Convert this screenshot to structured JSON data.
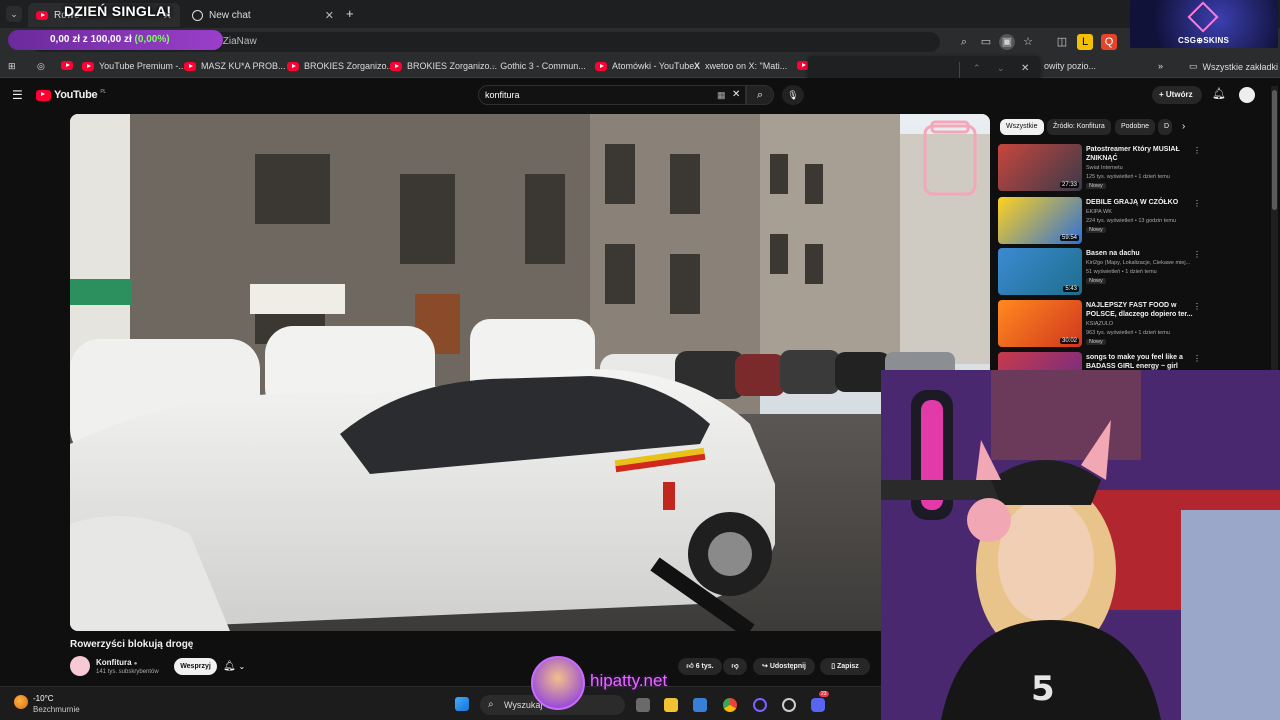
{
  "browser": {
    "tabs": [
      {
        "label": "Rowe",
        "active": true
      },
      {
        "label": "New chat",
        "active": false
      }
    ],
    "url_fragment": "/ZiaNaw",
    "bookmarks": [
      "YouTube Premium -...",
      "MASZ KU*A PROB...",
      "BROKIES Zorganizo...",
      "BROKIES Zorganizo...",
      "Gothic 3 - Commun...",
      "Atomówki - YouTube",
      "xwetoo on X: \"Mati...",
      "owity pozio..."
    ],
    "all_bookmarks_label": "Wszystkie zakładki"
  },
  "overlays": {
    "single_banner": "DZIEŃ SINGLA!",
    "donation_current": "0,00 zł",
    "donation_of": " z ",
    "donation_goal": "100,00 zł",
    "donation_percent": " (0,00%)",
    "csg_label": "CSG⊕SKINS",
    "hipatty": "hipatty.net"
  },
  "youtube": {
    "logo_text": "YouTube",
    "logo_region": "PL",
    "search_query": "konfitura",
    "create_label": "Utwórz",
    "video": {
      "title": "Rowerzyści blokują drogę",
      "channel": "Konfitura",
      "subscribers": "141 tys. subskrybentów",
      "support_label": "Wesprzyj",
      "likes": "6 tys.",
      "share_label": "Udostępnij",
      "save_label": "Zapisz"
    },
    "chips": [
      "Wszystkie",
      "Źródło: Konfitura",
      "Podobne",
      "D"
    ],
    "recommendations": [
      {
        "title": "Patostreamer Który MUSIAŁ ZNIKNĄĆ",
        "channel": "Świat Internetu",
        "meta": "125 tys. wyświetleń • 1 dzień temu",
        "badge": "Nowy",
        "duration": "27:33",
        "colors": [
          "#c8463c",
          "#3a3a4a"
        ]
      },
      {
        "title": "DEBILE GRAJĄ W CZÓŁKO",
        "channel": "EKIPA WK",
        "meta": "224 tys. wyświetleń • 13 godzin temu",
        "badge": "Nowy",
        "duration": "59:54",
        "colors": [
          "#ffd21f",
          "#2f6fd6"
        ]
      },
      {
        "title": "Basen na dachu",
        "channel": "Kiri2go (Mapy, Lokalizacje, Ciekawe miej...",
        "meta": "51 wyświetleń • 1 dzień temu",
        "badge": "Nowy",
        "duration": "5:43",
        "colors": [
          "#3c8ad1",
          "#1d6e8f"
        ]
      },
      {
        "title": "NAJLEPSZY FAST FOOD w POLSCE, dlaczego dopiero ter...",
        "channel": "KSIĄŻULO",
        "meta": "963 tys. wyświetleń • 1 dzień temu",
        "badge": "Nowy",
        "duration": "30:02",
        "colors": [
          "#ff8a1f",
          "#d1361d"
        ]
      },
      {
        "title": "songs to make you feel like a BADASS GIRL energy ~ girl",
        "channel": "",
        "meta": "",
        "badge": "",
        "duration": "",
        "colors": [
          "#c83a4a",
          "#6b2a8a"
        ]
      }
    ]
  },
  "taskbar": {
    "weather_temp": "-10°C",
    "weather_desc": "Bezchmurnie",
    "search_placeholder": "Wyszukaj",
    "discord_badge": "23"
  }
}
